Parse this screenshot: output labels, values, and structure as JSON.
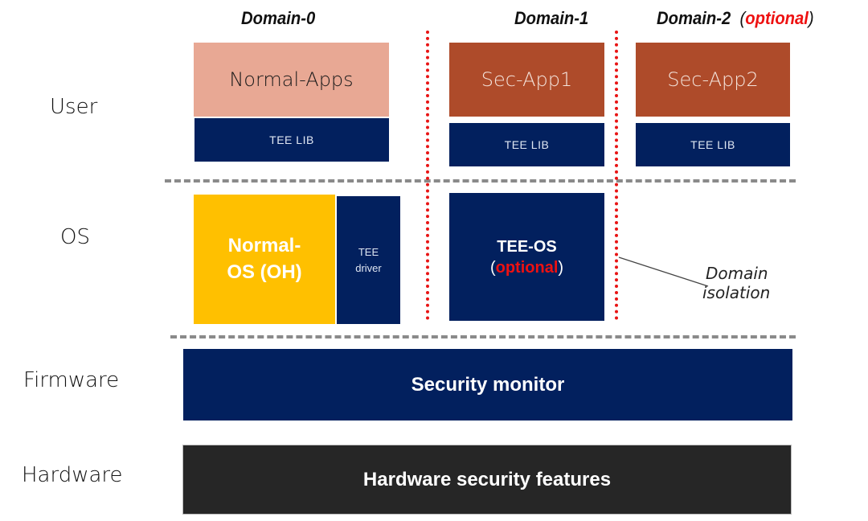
{
  "diagram": {
    "domains": {
      "domain0": "Domain-0",
      "domain1": "Domain-1",
      "domain2": "Domain-2",
      "domain2_paren_open": "(",
      "domain2_optional": "optional",
      "domain2_paren_close": ")"
    },
    "layers": {
      "user": "User",
      "os": "OS",
      "firmware": "Firmware",
      "hardware": "Hardware"
    },
    "user_layer": {
      "normal_apps": "Normal-Apps",
      "sec_app1": "Sec-App1",
      "sec_app2": "Sec-App2",
      "tee_lib": "TEE LIB"
    },
    "os_layer": {
      "normal_os_line1": "Normal-",
      "normal_os_line2": "OS (OH)",
      "tee_driver_line1": "TEE",
      "tee_driver_line2": "driver",
      "tee_os_line1": "TEE-OS",
      "tee_os_paren_open": "(",
      "tee_os_optional": "optional",
      "tee_os_paren_close": ")"
    },
    "annotation": {
      "line1": "Domain",
      "line2": "isolation"
    },
    "firmware_layer": {
      "security_monitor": "Security monitor"
    },
    "hardware_layer": {
      "hardware_security_features": "Hardware security features"
    },
    "colors": {
      "navy": "#02205e",
      "salmon": "#e8a894",
      "rust": "#ae4b2a",
      "gold": "#ffc000",
      "dark": "#262626",
      "red_accent": "#ee1111",
      "dash_gray": "#8a8a8a"
    }
  }
}
